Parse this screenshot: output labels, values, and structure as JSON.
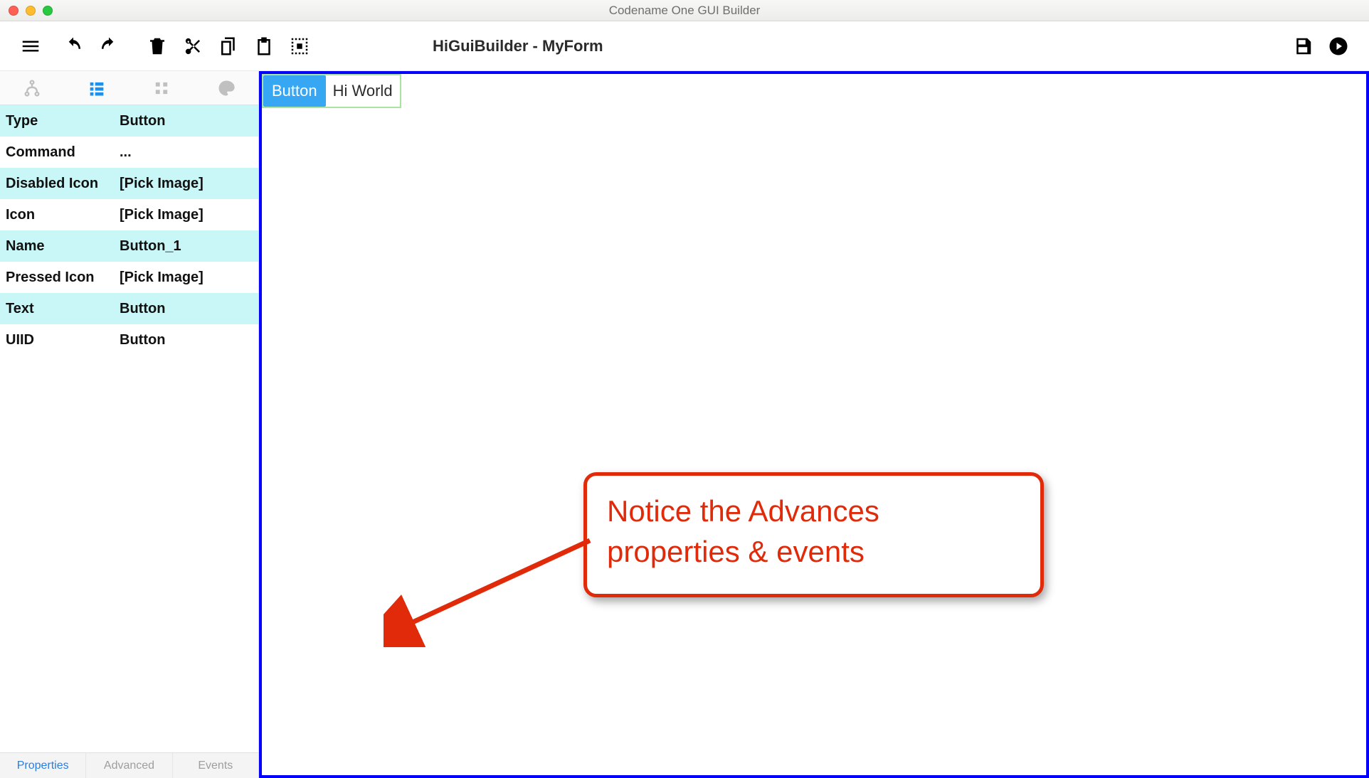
{
  "window": {
    "title": "Codename One GUI Builder"
  },
  "toolbar": {
    "form_title": "HiGuiBuilder - MyForm"
  },
  "sidetabs": {
    "items": [
      "tree",
      "list",
      "grid",
      "palette"
    ],
    "active": 1
  },
  "properties": {
    "rows": [
      {
        "k": "Type",
        "v": "Button"
      },
      {
        "k": "Command",
        "v": "..."
      },
      {
        "k": "Disabled Icon",
        "v": "[Pick Image]"
      },
      {
        "k": "Icon",
        "v": "[Pick Image]"
      },
      {
        "k": "Name",
        "v": "Button_1"
      },
      {
        "k": "Pressed Icon",
        "v": "[Pick Image]"
      },
      {
        "k": "Text",
        "v": "Button"
      },
      {
        "k": "UIID",
        "v": "Button"
      }
    ]
  },
  "bottomtabs": {
    "tabs": [
      {
        "label": "Properties"
      },
      {
        "label": "Advanced"
      },
      {
        "label": "Events"
      }
    ],
    "active": 0
  },
  "canvas": {
    "button_text": "Button",
    "label_text": "Hi World"
  },
  "annotation": {
    "text": "Notice the Advances properties & events"
  },
  "colors": {
    "accent": "#1b90ed",
    "selection": "#37a7f4",
    "form_border": "#0400fb",
    "callout": "#e12a0a"
  }
}
